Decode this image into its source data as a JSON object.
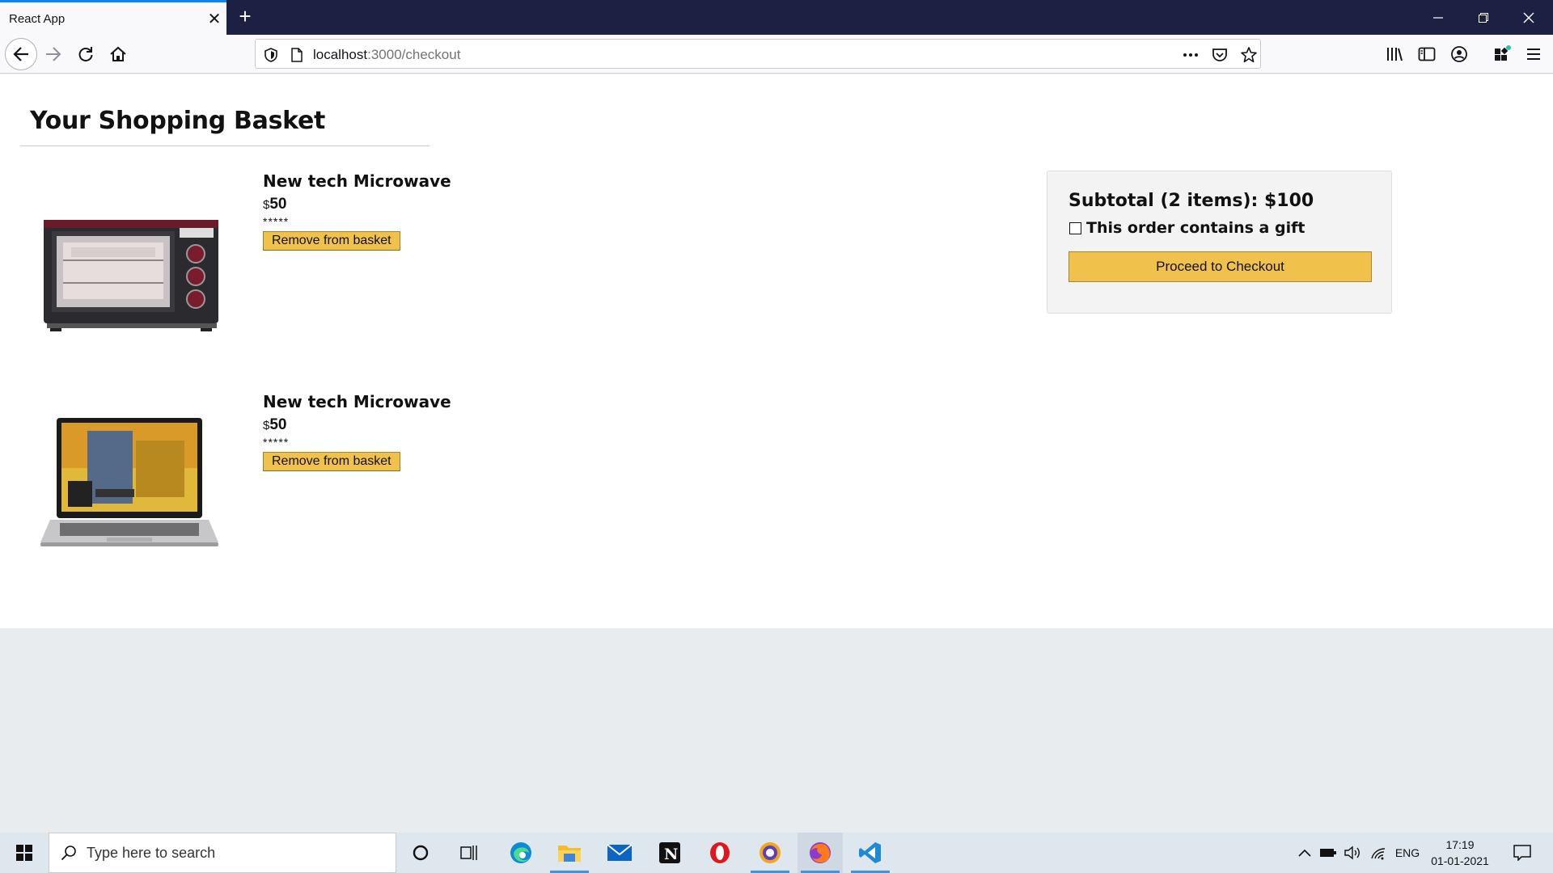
{
  "browser": {
    "tab_title": "React App",
    "url_host": "localhost",
    "url_rest": ":3000/checkout"
  },
  "page": {
    "title": "Your Shopping Basket",
    "products": [
      {
        "title": "New tech Microwave",
        "currency": "$",
        "price": "50",
        "rating": "*****",
        "remove_label": "Remove from basket",
        "image": "toaster-oven-image"
      },
      {
        "title": "New tech Microwave",
        "currency": "$",
        "price": "50",
        "rating": "*****",
        "remove_label": "Remove from basket",
        "image": "laptop-image"
      }
    ],
    "subtotal": {
      "text": "Subtotal (2 items): $100",
      "gift_label": "This order contains a gift",
      "gift_checked": false,
      "checkout_label": "Proceed to Checkout"
    }
  },
  "taskbar": {
    "search_placeholder": "Type here to search",
    "language": "ENG",
    "time": "17:19",
    "date": "01-01-2021"
  },
  "colors": {
    "accent_button": "#f0c14b",
    "tabbar": "#1c2143",
    "active_tab_line": "#0a84ff"
  }
}
